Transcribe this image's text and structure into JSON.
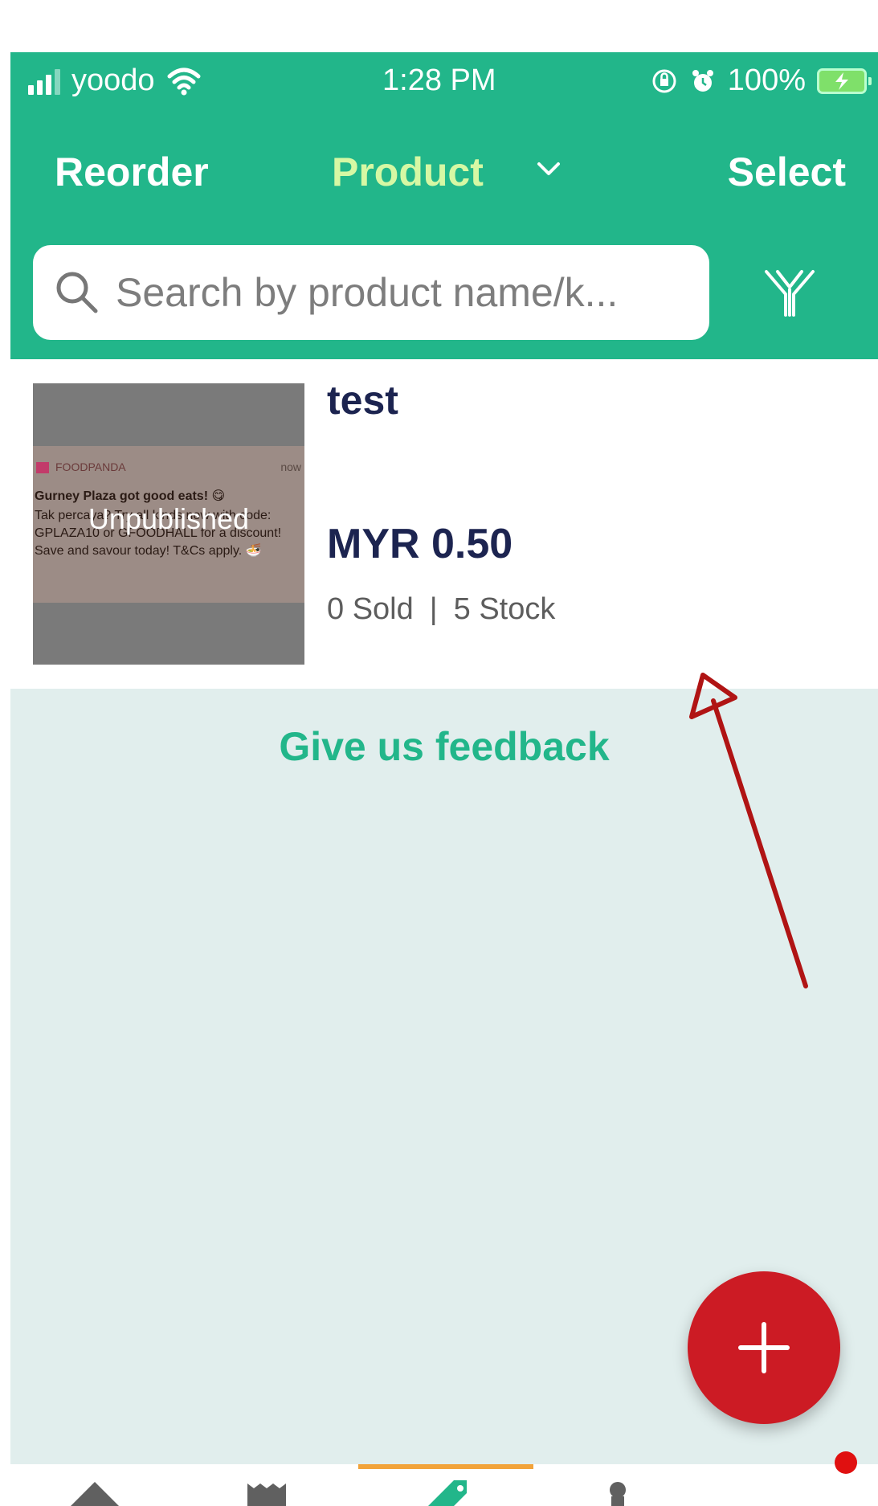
{
  "status_bar": {
    "carrier": "yoodo",
    "time": "1:28 PM",
    "battery": "100%"
  },
  "header": {
    "reorder_label": "Reorder",
    "title": "Product",
    "select_label": "Select"
  },
  "search": {
    "placeholder": "Search by product name/k..."
  },
  "products": [
    {
      "name": "test",
      "price": "MYR 0.50",
      "sold": "0 Sold",
      "stock": "5 Stock",
      "status_badge": "Unpublished",
      "thumbnail": {
        "app": "FOODPANDA",
        "time": "now",
        "headline": "Gurney Plaza got good eats! 😋",
        "body": "Tak percaya? Try all kinds now with code: GPLAZA10 or GFOODHALL for a discount! Save and savour today! T&Cs apply. 🍜"
      }
    }
  ],
  "feedback_label": "Give us feedback",
  "colors": {
    "brand": "#22b68a",
    "header_title": "#d6f8a4",
    "fab": "#cc1b24",
    "tab_indicator": "#f2a33a",
    "text_dark": "#1c2450",
    "annotation_arrow": "#b01414"
  },
  "icons": {
    "search": "search-icon",
    "filter": "filter-icon",
    "add": "plus-icon",
    "dropdown": "chevron-down-icon"
  }
}
